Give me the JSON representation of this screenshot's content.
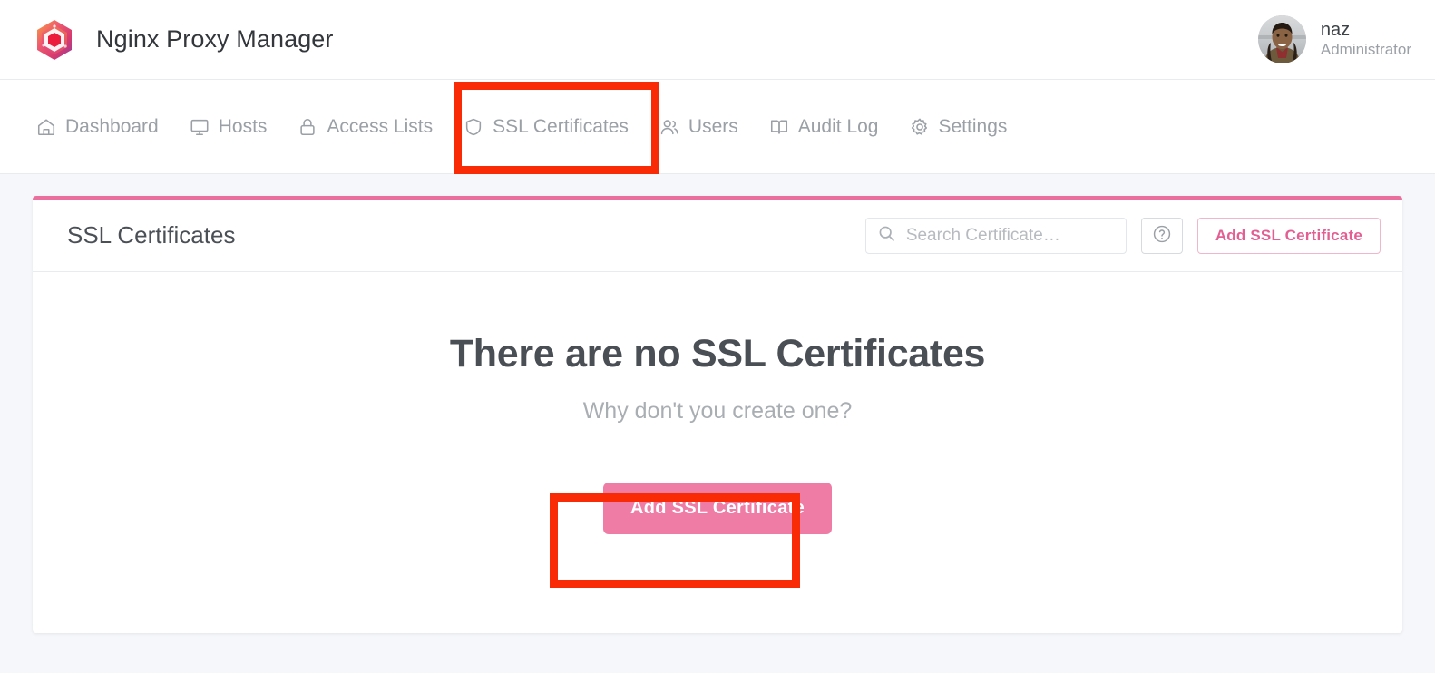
{
  "header": {
    "brand_title": "Nginx Proxy Manager",
    "logo_icon": "npm-hexagon-logo",
    "user": {
      "name": "naz",
      "role": "Administrator",
      "avatar_icon": "user-avatar-photo"
    }
  },
  "nav": {
    "items": [
      {
        "label": "Dashboard",
        "icon": "home-icon",
        "name": "nav-item-dashboard"
      },
      {
        "label": "Hosts",
        "icon": "monitor-icon",
        "name": "nav-item-hosts"
      },
      {
        "label": "Access Lists",
        "icon": "lock-icon",
        "name": "nav-item-access-lists"
      },
      {
        "label": "SSL Certificates",
        "icon": "shield-icon",
        "name": "nav-item-ssl-certificates"
      },
      {
        "label": "Users",
        "icon": "users-icon",
        "name": "nav-item-users"
      },
      {
        "label": "Audit Log",
        "icon": "book-icon",
        "name": "nav-item-audit-log"
      },
      {
        "label": "Settings",
        "icon": "gear-icon",
        "name": "nav-item-settings"
      }
    ]
  },
  "card": {
    "title": "SSL Certificates",
    "search": {
      "value": "",
      "placeholder": "Search Certificate…",
      "icon": "search-icon"
    },
    "help_button": {
      "icon": "question-circle-icon"
    },
    "add_button_label": "Add SSL Certificate"
  },
  "empty_state": {
    "title": "There are no SSL Certificates",
    "subtitle": "Why don't you create one?",
    "button_label": "Add SSL Certificate"
  },
  "annotations": {
    "highlight_color": "#f92b07",
    "boxes": [
      {
        "target": "nav-item-ssl-certificates"
      },
      {
        "target": "empty-state-add-ssl-certificate-button"
      }
    ]
  },
  "colors": {
    "accent_pink": "#eb6f9c",
    "primary_button": "#ef7ca5",
    "outline_button_text": "#e35e92",
    "page_background": "#f5f7fa",
    "highlight_red": "#f92b07"
  }
}
